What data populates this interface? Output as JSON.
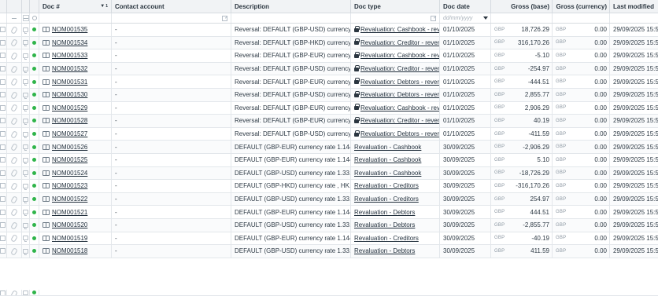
{
  "columns": {
    "doc_no": "Doc #",
    "sort_number": "1",
    "contact": "Contact account",
    "description": "Description",
    "doc_type": "Doc type",
    "doc_date": "Doc date",
    "gross_base": "Gross (base)",
    "gross_currency": "Gross (currency)",
    "last_modified": "Last modified"
  },
  "filters": {
    "doc_date_placeholder": "dd/mm/yyyy"
  },
  "rows": [
    {
      "doc": "NOM001535",
      "contact": "-",
      "desc": "Reversal: DEFAULT (GBP-USD) currency ...",
      "locked": true,
      "type": "Revaluation: Cashbook - rev",
      "date": "01/10/2025",
      "base_cur": "GBP",
      "base": "18,726.29",
      "cur": "GBP",
      "gross": "0.00",
      "modified": "29/09/2025 15:5"
    },
    {
      "doc": "NOM001534",
      "contact": "-",
      "desc": "Reversal: DEFAULT (GBP-HKD) currency ...",
      "locked": true,
      "type": "Revaluation: Creditor - rever",
      "date": "01/10/2025",
      "base_cur": "GBP",
      "base": "316,170.26",
      "cur": "GBP",
      "gross": "0.00",
      "modified": "29/09/2025 15:5"
    },
    {
      "doc": "NOM001533",
      "contact": "-",
      "desc": "Reversal: DEFAULT (GBP-EUR) currency ...",
      "locked": true,
      "type": "Revaluation: Cashbook - rev",
      "date": "01/10/2025",
      "base_cur": "GBP",
      "base": "-5.10",
      "cur": "GBP",
      "gross": "0.00",
      "modified": "29/09/2025 15:5"
    },
    {
      "doc": "NOM001532",
      "contact": "-",
      "desc": "Reversal: DEFAULT (GBP-USD) currency ...",
      "locked": true,
      "type": "Revaluation: Creditor - rever",
      "date": "01/10/2025",
      "base_cur": "GBP",
      "base": "-254.97",
      "cur": "GBP",
      "gross": "0.00",
      "modified": "29/09/2025 15:5"
    },
    {
      "doc": "NOM001531",
      "contact": "-",
      "desc": "Reversal: DEFAULT (GBP-EUR) currency ...",
      "locked": true,
      "type": "Revaluation: Debtors - rever",
      "date": "01/10/2025",
      "base_cur": "GBP",
      "base": "-444.51",
      "cur": "GBP",
      "gross": "0.00",
      "modified": "29/09/2025 15:5"
    },
    {
      "doc": "NOM001530",
      "contact": "-",
      "desc": "Reversal: DEFAULT (GBP-USD) currency ...",
      "locked": true,
      "type": "Revaluation: Debtors - rever",
      "date": "01/10/2025",
      "base_cur": "GBP",
      "base": "2,855.77",
      "cur": "GBP",
      "gross": "0.00",
      "modified": "29/09/2025 15:5"
    },
    {
      "doc": "NOM001529",
      "contact": "-",
      "desc": "Reversal: DEFAULT (GBP-EUR) currency ...",
      "locked": true,
      "type": "Revaluation: Cashbook - rev",
      "date": "01/10/2025",
      "base_cur": "GBP",
      "base": "2,906.29",
      "cur": "GBP",
      "gross": "0.00",
      "modified": "29/09/2025 15:5"
    },
    {
      "doc": "NOM001528",
      "contact": "-",
      "desc": "Reversal: DEFAULT (GBP-EUR) currency ...",
      "locked": true,
      "type": "Revaluation: Creditor - rever",
      "date": "01/10/2025",
      "base_cur": "GBP",
      "base": "40.19",
      "cur": "GBP",
      "gross": "0.00",
      "modified": "29/09/2025 15:5"
    },
    {
      "doc": "NOM001527",
      "contact": "-",
      "desc": "Reversal: DEFAULT (GBP-USD) currency ...",
      "locked": true,
      "type": "Revaluation: Debtors - rever",
      "date": "01/10/2025",
      "base_cur": "GBP",
      "base": "-411.59",
      "cur": "GBP",
      "gross": "0.00",
      "modified": "29/09/2025 15:5"
    },
    {
      "doc": "NOM001526",
      "contact": "-",
      "desc": "DEFAULT (GBP-EUR) currency rate 1.144...",
      "locked": false,
      "type": "Revaluation - Cashbook",
      "date": "30/09/2025",
      "base_cur": "GBP",
      "base": "-2,906.29",
      "cur": "GBP",
      "gross": "0.00",
      "modified": "29/09/2025 15:5"
    },
    {
      "doc": "NOM001525",
      "contact": "-",
      "desc": "DEFAULT (GBP-EUR) currency rate 1.144...",
      "locked": false,
      "type": "Revaluation - Cashbook",
      "date": "30/09/2025",
      "base_cur": "GBP",
      "base": "5.10",
      "cur": "GBP",
      "gross": "0.00",
      "modified": "29/09/2025 15:5"
    },
    {
      "doc": "NOM001524",
      "contact": "-",
      "desc": "DEFAULT (GBP-USD) currency rate 1.33...",
      "locked": false,
      "type": "Revaluation - Cashbook",
      "date": "30/09/2025",
      "base_cur": "GBP",
      "base": "-18,726.29",
      "cur": "GBP",
      "gross": "0.00",
      "modified": "29/09/2025 15:5"
    },
    {
      "doc": "NOM001523",
      "contact": "-",
      "desc": "DEFAULT (GBP-HKD) currency rate , HK...",
      "locked": false,
      "type": "Revaluation - Creditors",
      "date": "30/09/2025",
      "base_cur": "GBP",
      "base": "-316,170.26",
      "cur": "GBP",
      "gross": "0.00",
      "modified": "29/09/2025 15:5"
    },
    {
      "doc": "NOM001522",
      "contact": "-",
      "desc": "DEFAULT (GBP-USD) currency rate 1.33...",
      "locked": false,
      "type": "Revaluation - Creditors",
      "date": "30/09/2025",
      "base_cur": "GBP",
      "base": "254.97",
      "cur": "GBP",
      "gross": "0.00",
      "modified": "29/09/2025 15:5"
    },
    {
      "doc": "NOM001521",
      "contact": "-",
      "desc": "DEFAULT (GBP-EUR) currency rate 1.144...",
      "locked": false,
      "type": "Revaluation - Debtors",
      "date": "30/09/2025",
      "base_cur": "GBP",
      "base": "444.51",
      "cur": "GBP",
      "gross": "0.00",
      "modified": "29/09/2025 15:5"
    },
    {
      "doc": "NOM001520",
      "contact": "-",
      "desc": "DEFAULT (GBP-USD) currency rate 1.33...",
      "locked": false,
      "type": "Revaluation - Debtors",
      "date": "30/09/2025",
      "base_cur": "GBP",
      "base": "-2,855.77",
      "cur": "GBP",
      "gross": "0.00",
      "modified": "29/09/2025 15:5"
    },
    {
      "doc": "NOM001519",
      "contact": "-",
      "desc": "DEFAULT (GBP-EUR) currency rate 1.144...",
      "locked": false,
      "type": "Revaluation - Creditors",
      "date": "30/09/2025",
      "base_cur": "GBP",
      "base": "-40.19",
      "cur": "GBP",
      "gross": "0.00",
      "modified": "29/09/2025 15:5"
    },
    {
      "doc": "NOM001518",
      "contact": "-",
      "desc": "DEFAULT (GBP-USD) currency rate 1.33...",
      "locked": false,
      "type": "Revaluation - Debtors",
      "date": "30/09/2025",
      "base_cur": "GBP",
      "base": "411.59",
      "cur": "GBP",
      "gross": "0.00",
      "modified": "29/09/2025 15:5"
    }
  ],
  "colors": {
    "status_dot": "#2fb44a",
    "header_bg": "#f1f3f5",
    "grid_line": "#e3e7eb"
  }
}
